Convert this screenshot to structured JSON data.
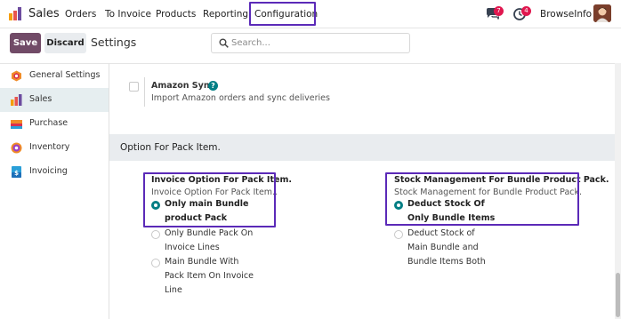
{
  "app": {
    "name": "Sales",
    "nav": [
      "Orders",
      "To Invoice",
      "Products",
      "Reporting",
      "Configuration"
    ],
    "messages_badge": "7",
    "activities_badge": "4",
    "company": "BrowseInfo"
  },
  "control": {
    "save_label": "Save",
    "discard_label": "Discard",
    "title": "Settings",
    "search_placeholder": "Search..."
  },
  "sidebar": {
    "items": [
      {
        "label": "General Settings",
        "icon": "general-settings-icon",
        "active": false
      },
      {
        "label": "Sales",
        "icon": "sales-icon",
        "active": true
      },
      {
        "label": "Purchase",
        "icon": "purchase-icon",
        "active": false
      },
      {
        "label": "Inventory",
        "icon": "inventory-icon",
        "active": false
      },
      {
        "label": "Invoicing",
        "icon": "invoicing-icon",
        "active": false
      }
    ]
  },
  "amazon": {
    "title": "Amazon Sync",
    "help": "?",
    "description": "Import Amazon orders and sync deliveries",
    "checked": false
  },
  "pack_section": {
    "title": "Option For Pack Item.",
    "invoice": {
      "title": "Invoice Option For Pack Item.",
      "description": "Invoice Option For Pack Item..",
      "options": [
        {
          "label": "Only main Bundle product Pack",
          "selected": true
        },
        {
          "label": "Only Bundle Pack On Invoice Lines",
          "selected": false
        },
        {
          "label": "Main Bundle With Pack Item On Invoice Line",
          "selected": false
        }
      ]
    },
    "stock": {
      "title": "Stock Management For Bundle Product Pack.",
      "description": "Stock Management for Bundle Product Pack.",
      "options": [
        {
          "label": "Deduct Stock Of Only Bundle Items",
          "selected": true
        },
        {
          "label": "Deduct Stock of Main Bundle and Bundle Items Both",
          "selected": false
        }
      ]
    }
  },
  "colors": {
    "primary": "#714b67",
    "accent": "#017e84",
    "highlight": "#5b2ab8",
    "badge": "#e0174f"
  }
}
